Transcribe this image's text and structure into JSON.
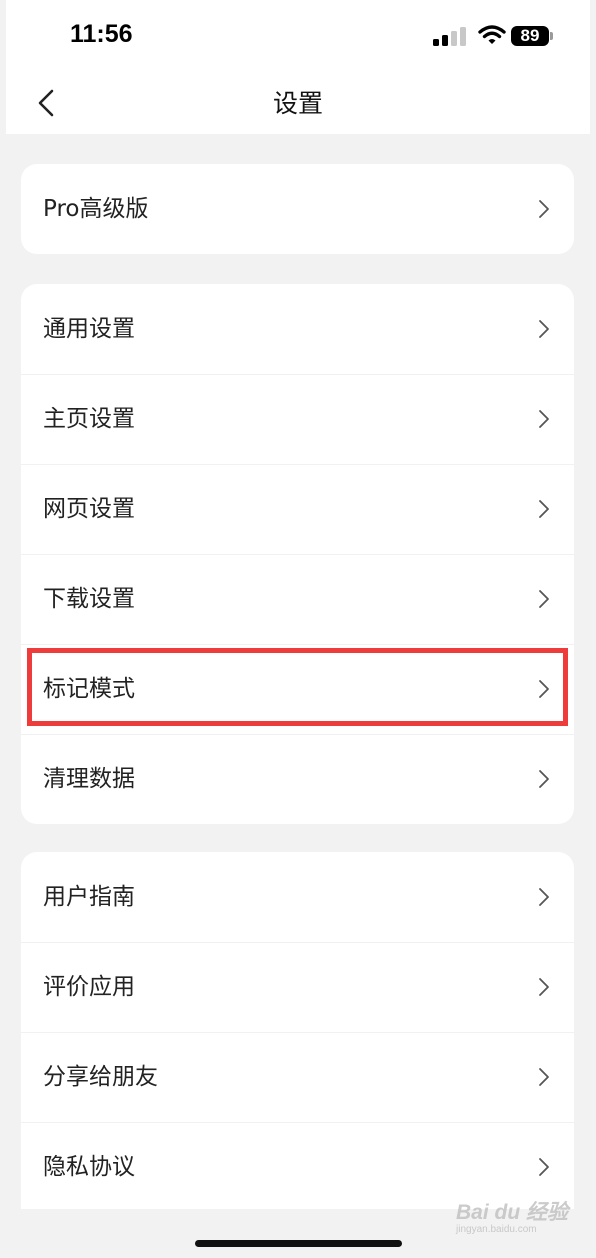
{
  "status_bar": {
    "time": "11:56",
    "battery": "89"
  },
  "nav": {
    "title": "设置"
  },
  "groups": [
    {
      "items": [
        {
          "label": "Pro高级版"
        }
      ]
    },
    {
      "items": [
        {
          "label": "通用设置"
        },
        {
          "label": "主页设置"
        },
        {
          "label": "网页设置"
        },
        {
          "label": "下载设置"
        },
        {
          "label": "标记模式",
          "highlighted": true
        },
        {
          "label": "清理数据"
        }
      ]
    },
    {
      "items": [
        {
          "label": "用户指南"
        },
        {
          "label": "评价应用"
        },
        {
          "label": "分享给朋友"
        },
        {
          "label": "隐私协议"
        }
      ]
    }
  ],
  "watermark": {
    "main": "Bai du 经验",
    "sub": "jingyan.baidu.com"
  },
  "colors": {
    "highlight": "#ee3b3b",
    "background": "#f2f2f2",
    "card": "#ffffff"
  }
}
